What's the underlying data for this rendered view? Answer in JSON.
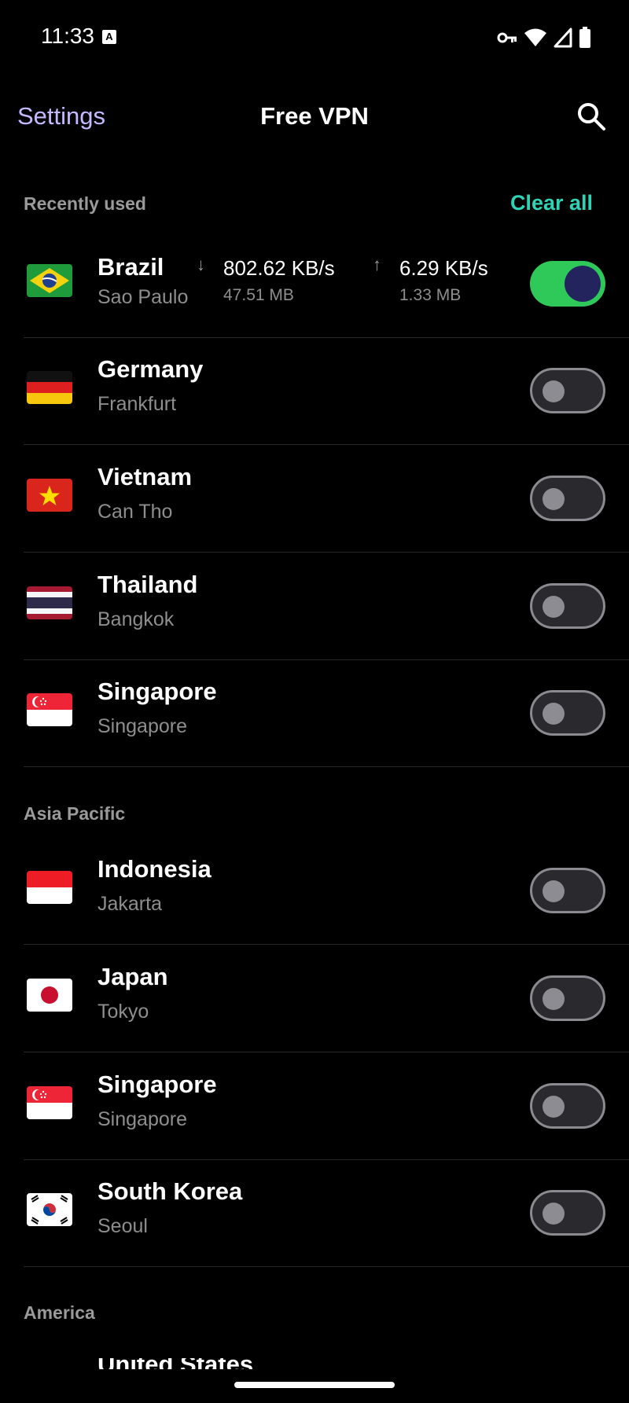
{
  "status": {
    "time": "11:33",
    "a_badge": "A"
  },
  "app_bar": {
    "settings": "Settings",
    "title": "Free VPN"
  },
  "sections": {
    "recent": "Recently used",
    "clear_all": "Clear all",
    "asia": "Asia Pacific",
    "america": "America"
  },
  "brazil": {
    "country": "Brazil",
    "city": "Sao Paulo",
    "down_rate": "802.62 KB/s",
    "down_total": "47.51 MB",
    "up_rate": "6.29 KB/s",
    "up_total": "1.33 MB",
    "connected": true
  },
  "recent": [
    {
      "country": "Germany",
      "city": "Frankfurt",
      "flag": "germany"
    },
    {
      "country": "Vietnam",
      "city": "Can Tho",
      "flag": "vietnam"
    },
    {
      "country": "Thailand",
      "city": "Bangkok",
      "flag": "thailand"
    },
    {
      "country": "Singapore",
      "city": "Singapore",
      "flag": "singapore"
    }
  ],
  "asia": [
    {
      "country": "Indonesia",
      "city": "Jakarta",
      "flag": "indonesia"
    },
    {
      "country": "Japan",
      "city": "Tokyo",
      "flag": "japan"
    },
    {
      "country": "Singapore",
      "city": "Singapore",
      "flag": "singapore"
    },
    {
      "country": "South Korea",
      "city": "Seoul",
      "flag": "south-korea"
    }
  ],
  "america_partial": "United States",
  "colors": {
    "accent_settings": "#c6b9ff",
    "accent_clear": "#2fd3b6",
    "toggle_on": "#2fc95a"
  }
}
